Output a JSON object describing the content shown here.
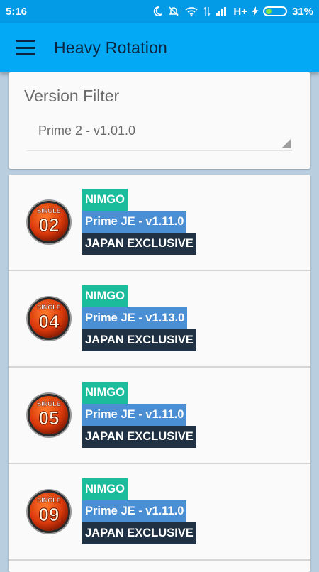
{
  "status_bar": {
    "time": "5:16",
    "network": "H+",
    "battery_percent": "31%",
    "battery_level": 0.31,
    "icons": [
      "moon-icon",
      "bell-off-icon",
      "wifi-icon",
      "data-arrows-icon",
      "signal-icon",
      "charging-icon",
      "battery-icon"
    ]
  },
  "app_bar": {
    "menu_icon": "hamburger-menu-icon",
    "title": "Heavy Rotation"
  },
  "filter": {
    "title": "Version Filter",
    "selected": "Prime 2 - v1.01.0"
  },
  "items": [
    {
      "badge_top": "SINGLE",
      "badge_number": "02",
      "channel": "NIMGO",
      "version": "Prime JE - v1.11.0",
      "region": "JAPAN EXCLUSIVE"
    },
    {
      "badge_top": "SINGLE",
      "badge_number": "04",
      "channel": "NIMGO",
      "version": "Prime JE - v1.13.0",
      "region": "JAPAN EXCLUSIVE"
    },
    {
      "badge_top": "SINGLE",
      "badge_number": "05",
      "channel": "NIMGO",
      "version": "Prime JE - v1.11.0",
      "region": "JAPAN EXCLUSIVE"
    },
    {
      "badge_top": "SINGLE",
      "badge_number": "09",
      "channel": "NIMGO",
      "version": "Prime JE - v1.11.0",
      "region": "JAPAN EXCLUSIVE"
    }
  ],
  "colors": {
    "status_bar": "#039be5",
    "app_bar": "#03a9f4",
    "tag_nimgo": "#1abc9c",
    "tag_version": "#4a8fd4",
    "tag_exclusive": "#1f3142",
    "badge_orange": "#e84a10"
  }
}
